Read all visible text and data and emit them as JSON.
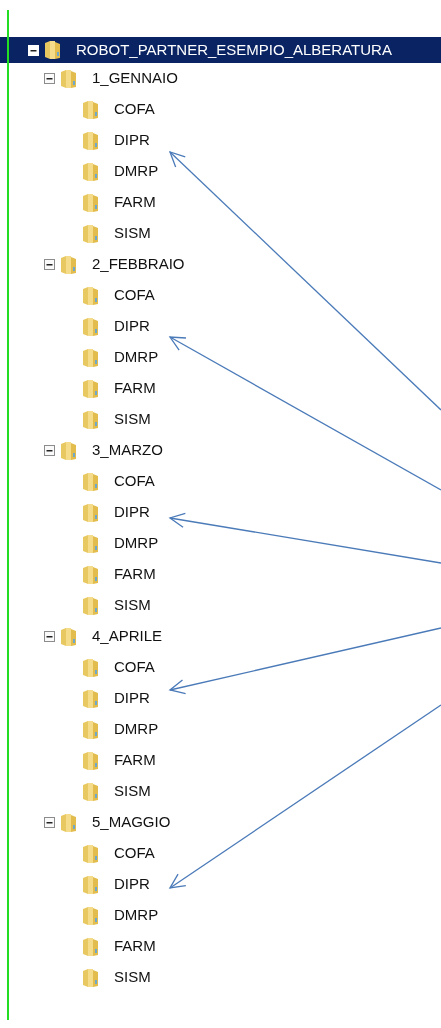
{
  "tree": [
    {
      "label": "ROBOT_PARTNER_ESEMPIO_ALBERATURA",
      "selected": true,
      "expanded": true,
      "children": [
        {
          "label": "1_GENNAIO",
          "selected": false,
          "expanded": true,
          "children": [
            {
              "label": "COFA",
              "selected": false
            },
            {
              "label": "DIPR",
              "selected": false
            },
            {
              "label": "DMRP",
              "selected": false
            },
            {
              "label": "FARM",
              "selected": false
            },
            {
              "label": "SISM",
              "selected": false
            }
          ]
        },
        {
          "label": "2_FEBBRAIO",
          "selected": false,
          "expanded": true,
          "children": [
            {
              "label": "COFA",
              "selected": false
            },
            {
              "label": "DIPR",
              "selected": false
            },
            {
              "label": "DMRP",
              "selected": false
            },
            {
              "label": "FARM",
              "selected": false
            },
            {
              "label": "SISM",
              "selected": false
            }
          ]
        },
        {
          "label": "3_MARZO",
          "selected": false,
          "expanded": true,
          "children": [
            {
              "label": "COFA",
              "selected": false
            },
            {
              "label": "DIPR",
              "selected": false
            },
            {
              "label": "DMRP",
              "selected": false
            },
            {
              "label": "FARM",
              "selected": false
            },
            {
              "label": "SISM",
              "selected": false
            }
          ]
        },
        {
          "label": "4_APRILE",
          "selected": false,
          "expanded": true,
          "children": [
            {
              "label": "COFA",
              "selected": false
            },
            {
              "label": "DIPR",
              "selected": false
            },
            {
              "label": "DMRP",
              "selected": false
            },
            {
              "label": "FARM",
              "selected": false
            },
            {
              "label": "SISM",
              "selected": false
            }
          ]
        },
        {
          "label": "5_MAGGIO",
          "selected": false,
          "expanded": true,
          "children": [
            {
              "label": "COFA",
              "selected": false
            },
            {
              "label": "DIPR",
              "selected": false
            },
            {
              "label": "DMRP",
              "selected": false
            },
            {
              "label": "FARM",
              "selected": false
            },
            {
              "label": "SISM",
              "selected": false
            }
          ]
        }
      ]
    }
  ]
}
